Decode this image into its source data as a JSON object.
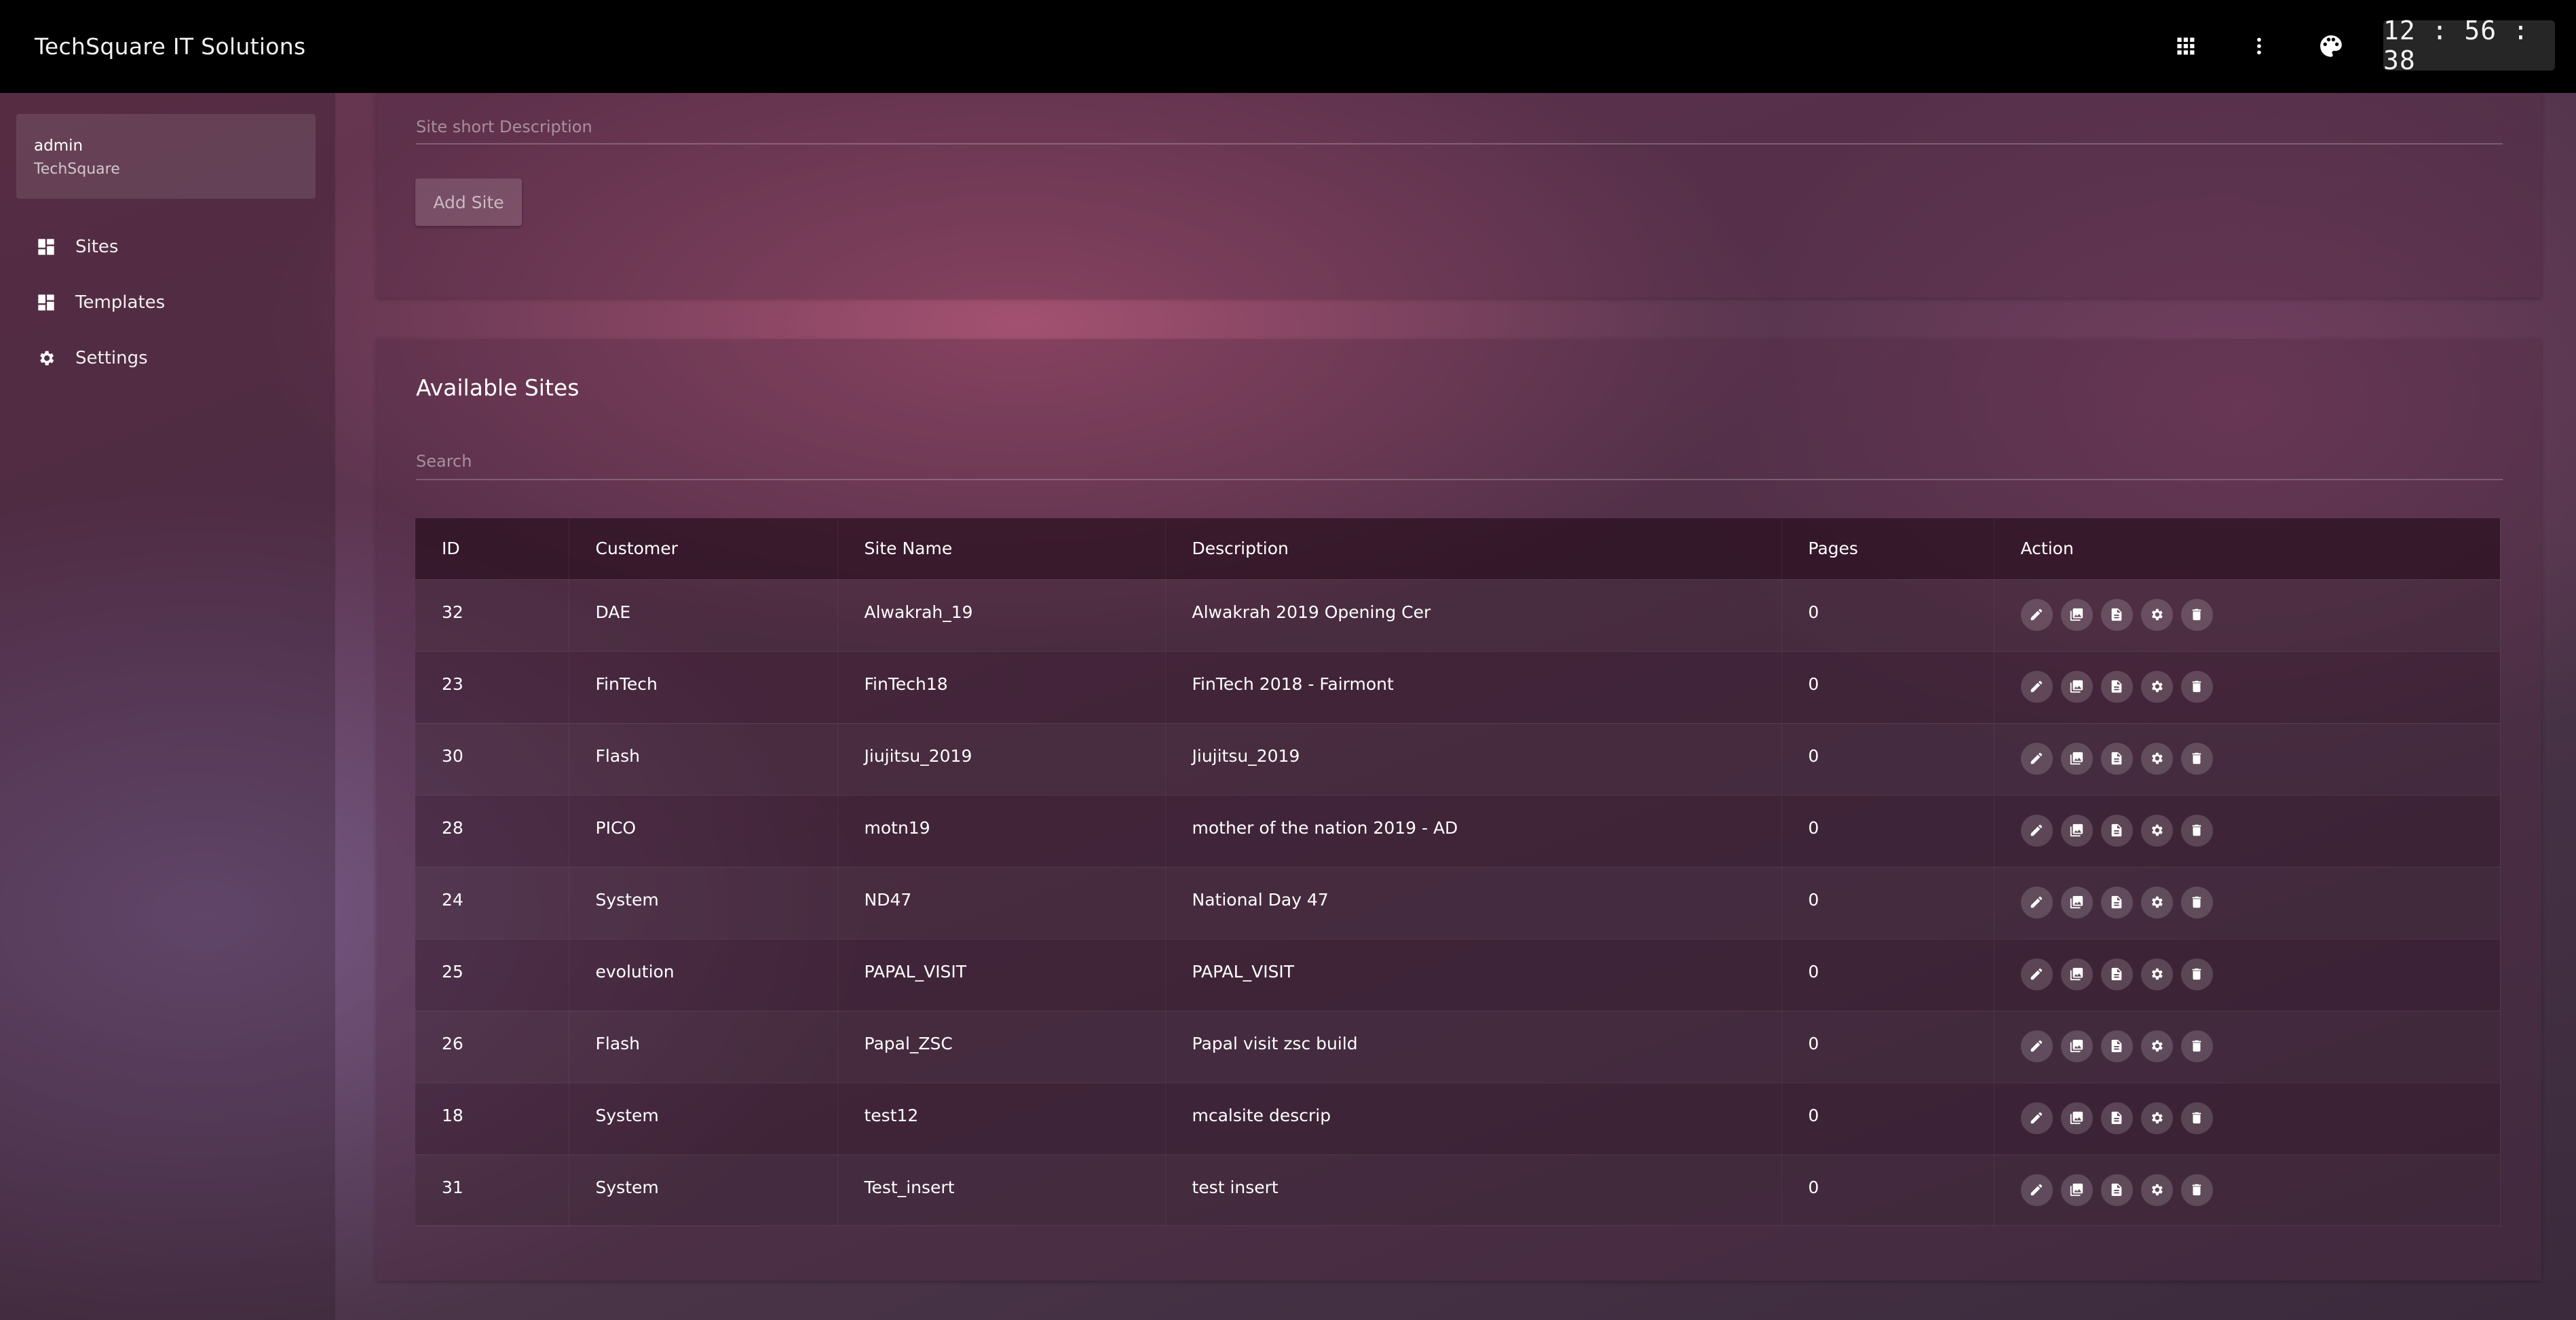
{
  "app": {
    "title": "TechSquare IT Solutions"
  },
  "topbar": {
    "icons": [
      "apps-grid-icon",
      "more-vert-icon",
      "palette-icon"
    ],
    "clock": "12 : 56 : 38"
  },
  "user": {
    "name": "admin",
    "org": "TechSquare"
  },
  "sidebar": {
    "items": [
      {
        "label": "Sites",
        "icon": "dashboard-icon"
      },
      {
        "label": "Templates",
        "icon": "dashboard-icon"
      },
      {
        "label": "Settings",
        "icon": "gear-icon"
      }
    ]
  },
  "add_site": {
    "desc_placeholder": "Site short Description",
    "button_label": "Add Site"
  },
  "sites": {
    "title": "Available Sites",
    "search_placeholder": "Search",
    "columns": [
      "ID",
      "Customer",
      "Site Name",
      "Description",
      "Pages",
      "Action"
    ],
    "rows": [
      {
        "id": "32",
        "customer": "DAE",
        "site_name": "Alwakrah_19",
        "description": "Alwakrah 2019 Opening Cer",
        "pages": "0"
      },
      {
        "id": "23",
        "customer": "FinTech",
        "site_name": "FinTech18",
        "description": "FinTech 2018 - Fairmont",
        "pages": "0"
      },
      {
        "id": "30",
        "customer": "Flash",
        "site_name": "Jiujitsu_2019",
        "description": "Jiujitsu_2019",
        "pages": "0"
      },
      {
        "id": "28",
        "customer": "PICO",
        "site_name": "motn19",
        "description": "mother of the nation 2019 - AD",
        "pages": "0"
      },
      {
        "id": "24",
        "customer": "System",
        "site_name": "ND47",
        "description": "National Day 47",
        "pages": "0"
      },
      {
        "id": "25",
        "customer": "evolution",
        "site_name": "PAPAL_VISIT",
        "description": "PAPAL_VISIT",
        "pages": "0"
      },
      {
        "id": "26",
        "customer": "Flash",
        "site_name": "Papal_ZSC",
        "description": "Papal visit zsc build",
        "pages": "0"
      },
      {
        "id": "18",
        "customer": "System",
        "site_name": "test12",
        "description": "mcalsite descrip",
        "pages": "0"
      },
      {
        "id": "31",
        "customer": "System",
        "site_name": "Test_insert",
        "description": "test insert",
        "pages": "0"
      }
    ],
    "row_actions": [
      "edit-icon",
      "gallery-icon",
      "document-icon",
      "settings-icon",
      "delete-icon"
    ]
  }
}
